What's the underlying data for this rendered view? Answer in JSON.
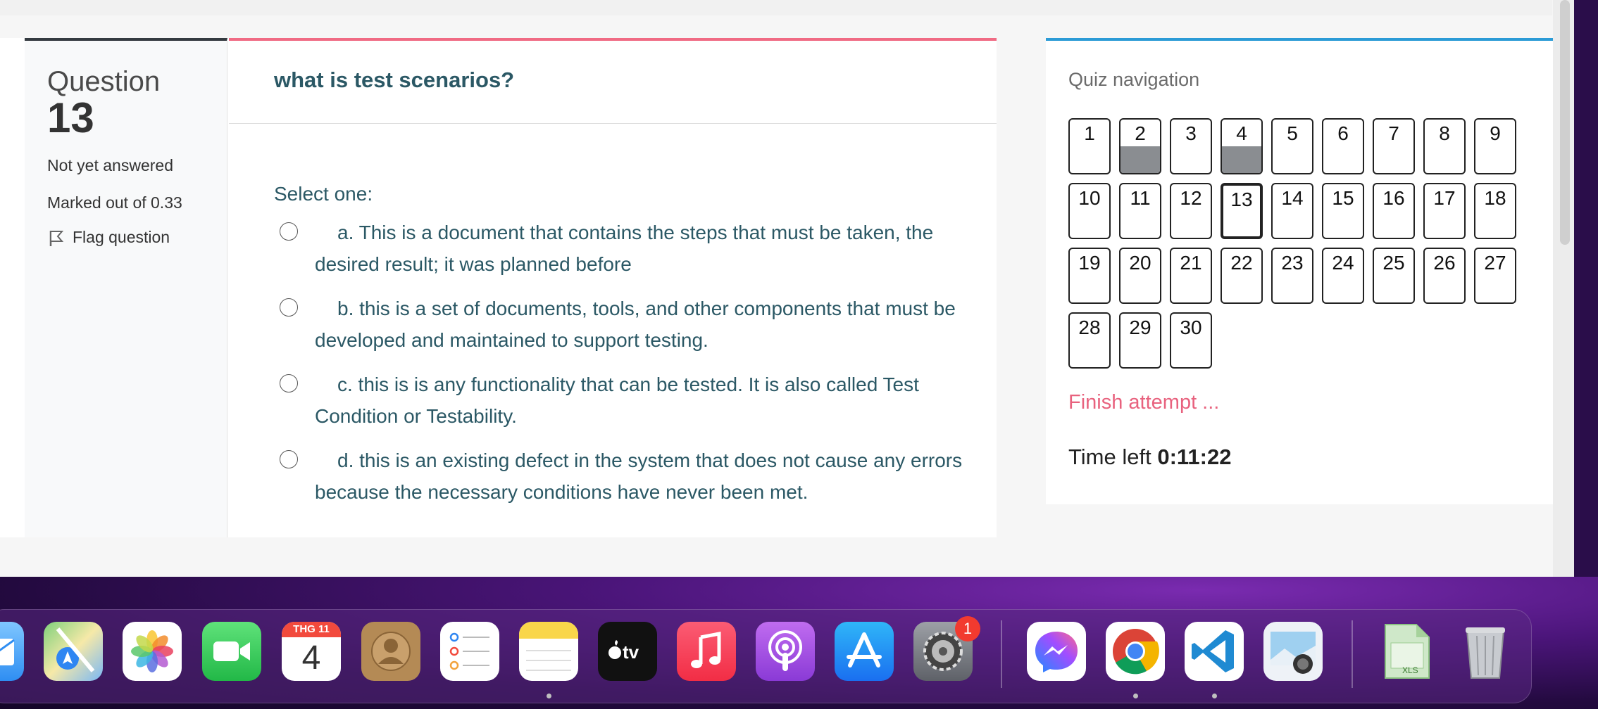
{
  "question_info": {
    "label": "Question",
    "number": "13",
    "status": "Not yet answered",
    "marked": "Marked out of 0.33",
    "flag_label": "Flag question"
  },
  "question": {
    "text": "what is test scenarios?",
    "prompt": "Select one:",
    "options": [
      {
        "text": "a. This is a document that contains the steps that must be taken, the desired result; it was planned before"
      },
      {
        "text": "b. this is a set of documents, tools, and other components that must be developed and maintained to support testing."
      },
      {
        "text": "c. this is is any functionality that can be tested. It is also called Test Condition or Testability."
      },
      {
        "text": "d. this is an existing defect in the system that does not cause any errors because the necessary conditions have never been met."
      }
    ]
  },
  "quiz_navigation": {
    "title": "Quiz navigation",
    "current": 13,
    "answered": [
      2,
      4
    ],
    "questions": [
      "1",
      "2",
      "3",
      "4",
      "5",
      "6",
      "7",
      "8",
      "9",
      "10",
      "11",
      "12",
      "13",
      "14",
      "15",
      "16",
      "17",
      "18",
      "19",
      "20",
      "21",
      "22",
      "23",
      "24",
      "25",
      "26",
      "27",
      "28",
      "29",
      "30"
    ],
    "finish_label": "Finish attempt ...",
    "time_left_label": "Time left",
    "time_left_value": "0:11:22"
  },
  "dock": {
    "calendar_month": "THG 11",
    "calendar_day": "4",
    "settings_badge": "1",
    "xls_label": "XLS",
    "apps": [
      "mail-icon",
      "maps-icon",
      "photos-icon",
      "facetime-icon",
      "calendar-icon",
      "contacts-icon",
      "reminders-icon",
      "notes-icon",
      "apple-tv-icon",
      "music-icon",
      "podcasts-icon",
      "app-store-icon",
      "system-settings-icon",
      "messenger-icon",
      "chrome-icon",
      "vscode-icon",
      "preview-icon",
      "xls-file-icon",
      "trash-icon"
    ]
  },
  "colors": {
    "accent_pink": "#f06b84",
    "accent_blue": "#2b9bd6",
    "question_text": "#2b5865"
  }
}
